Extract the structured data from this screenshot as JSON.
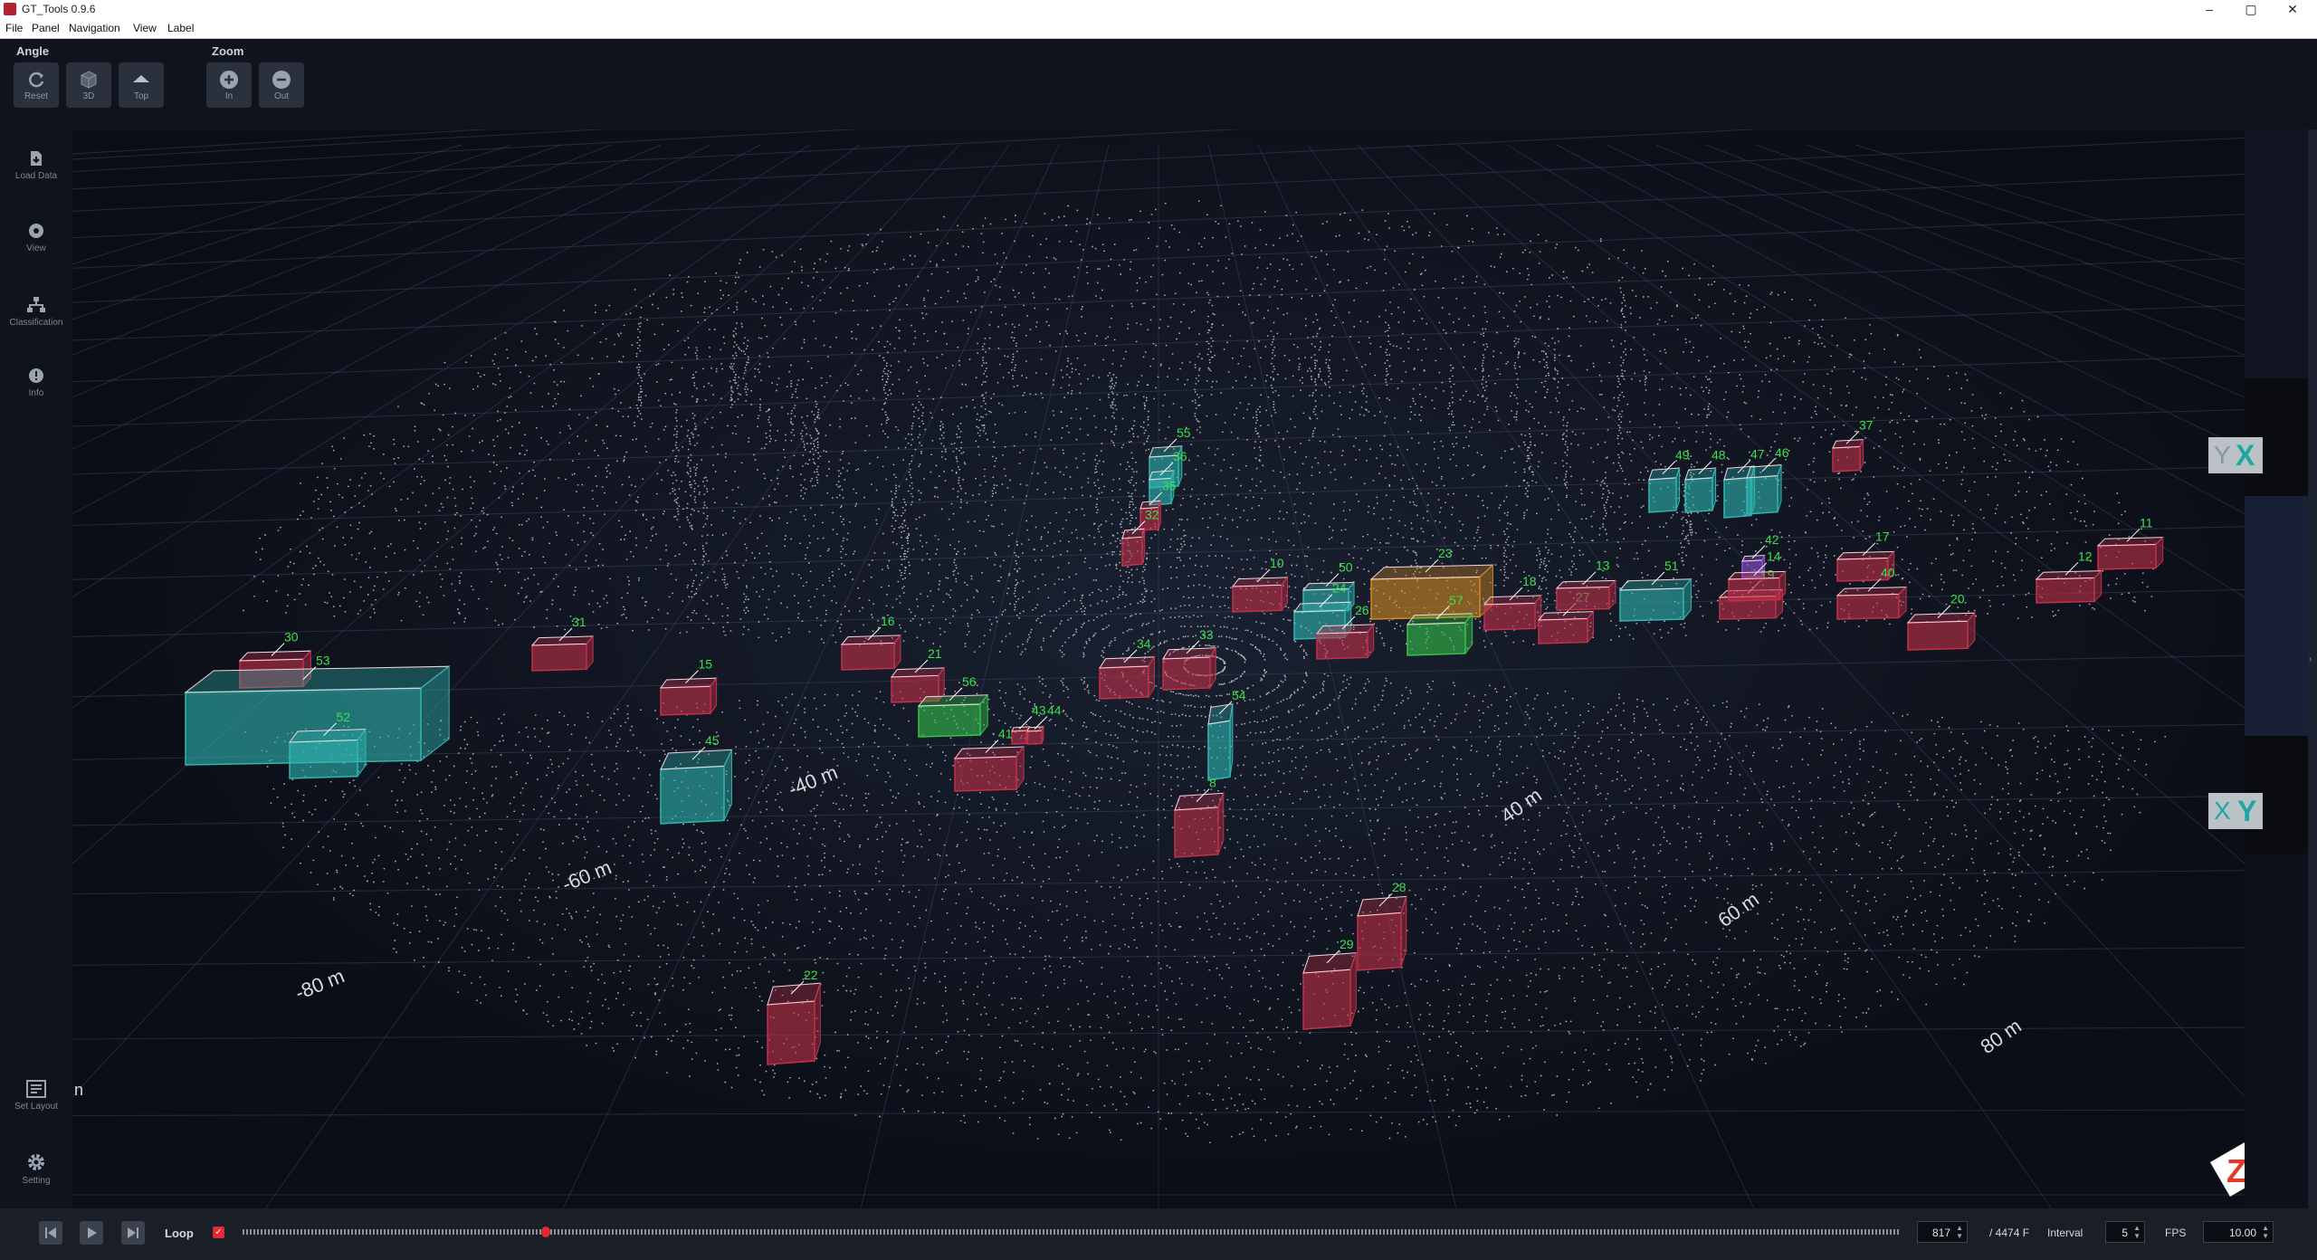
{
  "window": {
    "title": "GT_Tools 0.9.6",
    "minimize": "–",
    "maximize": "▢",
    "close": "✕"
  },
  "menu": [
    "File",
    "Panel",
    "Navigation",
    "View",
    "Label"
  ],
  "toolbar": {
    "angle_label": "Angle",
    "angle_buttons": [
      "Reset",
      "3D",
      "Top"
    ],
    "zoom_label": "Zoom",
    "zoom_buttons": [
      "In",
      "Out"
    ]
  },
  "sidebar": {
    "top": [
      "Load Data",
      "View",
      "Classification",
      "Info"
    ],
    "bottom": [
      "Set Layout",
      "Setting"
    ]
  },
  "viewport": {
    "axis_labels": [
      "-40 m",
      "-60 m",
      "-80 m",
      "40 m",
      "60 m",
      "80 m"
    ],
    "edge_glyph": "n",
    "gizmo_top": [
      "Y",
      "X"
    ],
    "gizmo_bottom": [
      "X",
      "Y"
    ],
    "z_axis": "Z",
    "colors": {
      "red_box": "#c2304a",
      "cyan_box": "#2fb6b1",
      "green_box": "#36c24a",
      "orange_box": "#d08a25",
      "purple_box": "#8f52d6",
      "label": "#3be04a",
      "points": "#e8ecf2"
    },
    "objects": [
      {
        "id": "30",
        "kind": "red"
      },
      {
        "id": "53",
        "kind": "cyan"
      },
      {
        "id": "52",
        "kind": "cyan"
      },
      {
        "id": "31",
        "kind": "red"
      },
      {
        "id": "15",
        "kind": "red"
      },
      {
        "id": "45",
        "kind": "cyan"
      },
      {
        "id": "16",
        "kind": "red"
      },
      {
        "id": "21",
        "kind": "red"
      },
      {
        "id": "56",
        "kind": "green"
      },
      {
        "id": "43",
        "kind": "red"
      },
      {
        "id": "44",
        "kind": "red"
      },
      {
        "id": "41",
        "kind": "red"
      },
      {
        "id": "34",
        "kind": "red"
      },
      {
        "id": "33",
        "kind": "red"
      },
      {
        "id": "54",
        "kind": "cyan"
      },
      {
        "id": "8",
        "kind": "red"
      },
      {
        "id": "55",
        "kind": "cyan"
      },
      {
        "id": "36",
        "kind": "cyan"
      },
      {
        "id": "35",
        "kind": "red"
      },
      {
        "id": "32",
        "kind": "red"
      },
      {
        "id": "10",
        "kind": "red"
      },
      {
        "id": "50",
        "kind": "cyan"
      },
      {
        "id": "24",
        "kind": "cyan"
      },
      {
        "id": "26",
        "kind": "red"
      },
      {
        "id": "23",
        "kind": "orange"
      },
      {
        "id": "57",
        "kind": "green"
      },
      {
        "id": "18",
        "kind": "red"
      },
      {
        "id": "27",
        "kind": "red"
      },
      {
        "id": "13",
        "kind": "red"
      },
      {
        "id": "51",
        "kind": "cyan"
      },
      {
        "id": "49",
        "kind": "cyan"
      },
      {
        "id": "48",
        "kind": "cyan"
      },
      {
        "id": "47",
        "kind": "cyan"
      },
      {
        "id": "46",
        "kind": "cyan"
      },
      {
        "id": "42",
        "kind": "purple"
      },
      {
        "id": "19",
        "kind": "red"
      },
      {
        "id": "14",
        "kind": "red"
      },
      {
        "id": "37",
        "kind": "red"
      },
      {
        "id": "17",
        "kind": "red"
      },
      {
        "id": "40",
        "kind": "red"
      },
      {
        "id": "20",
        "kind": "red"
      },
      {
        "id": "12",
        "kind": "red"
      },
      {
        "id": "11",
        "kind": "red"
      },
      {
        "id": "28",
        "kind": "red"
      },
      {
        "id": "29",
        "kind": "red"
      },
      {
        "id": "22",
        "kind": "red"
      }
    ]
  },
  "playback": {
    "loop_label": "Loop",
    "loop_checked": true,
    "frame": "817",
    "total": "/ 4474 F",
    "progress": 0.18,
    "interval_label": "Interval",
    "interval": "5",
    "fps_label": "FPS",
    "fps": "10.00"
  }
}
